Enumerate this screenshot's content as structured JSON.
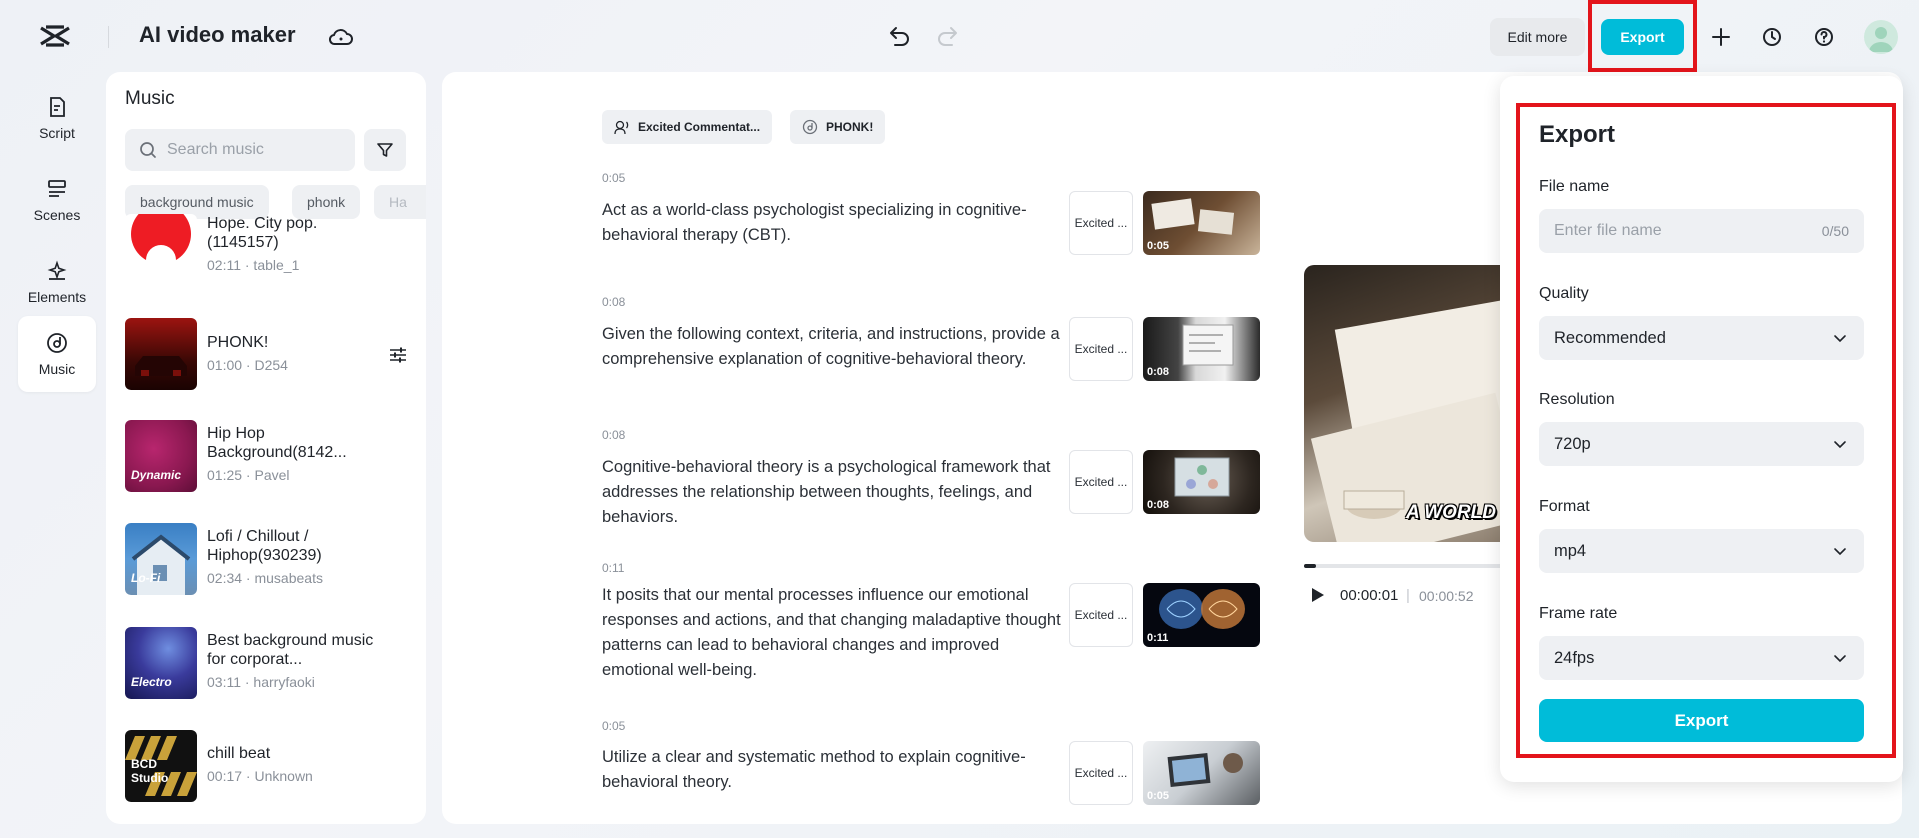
{
  "header": {
    "app_title": "AI video maker",
    "edit_more_label": "Edit more",
    "export_label": "Export"
  },
  "nav": {
    "items": [
      {
        "label": "Script",
        "icon": "script-icon"
      },
      {
        "label": "Scenes",
        "icon": "scenes-icon"
      },
      {
        "label": "Elements",
        "icon": "elements-icon"
      },
      {
        "label": "Music",
        "icon": "music-icon",
        "active": true
      }
    ]
  },
  "music": {
    "title": "Music",
    "search_placeholder": "Search music",
    "chips": [
      "background music",
      "phonk",
      "Ha"
    ],
    "tracks": [
      {
        "name": "Hope. City pop. (1145157)",
        "meta": "02:11 · table_1",
        "thumb_label": ""
      },
      {
        "name": "PHONK!",
        "meta": "01:00 · D254",
        "thumb_label": ""
      },
      {
        "name": "Hip Hop Background(8142...",
        "meta": "01:25 · Pavel",
        "thumb_label": "Dynamic"
      },
      {
        "name": "Lofi / Chillout / Hiphop(930239)",
        "meta": "02:34 · musabeats",
        "thumb_label": "Lo-Fi"
      },
      {
        "name": "Best background music for corporat...",
        "meta": "03:11 · harryfaoki",
        "thumb_label": "Electro"
      },
      {
        "name": "chill beat",
        "meta": "00:17 · Unknown",
        "thumb_label": "BCD Studio"
      }
    ]
  },
  "script": {
    "voice_chip": "Excited Commentat...",
    "music_chip": "PHONK!",
    "segments": [
      {
        "time": "0:05",
        "text": "Act as a world-class psychologist specializing in cognitive-behavioral therapy (CBT).",
        "voice": "Excited ...",
        "dur": "0:05"
      },
      {
        "time": "0:08",
        "text": "Given the following context, criteria, and instructions, provide a comprehensive explanation of cognitive-behavioral theory.",
        "voice": "Excited ...",
        "dur": "0:08"
      },
      {
        "time": "0:08",
        "text": "Cognitive-behavioral theory is a psychological framework that addresses the relationship between thoughts, feelings, and behaviors.",
        "voice": "Excited ...",
        "dur": "0:08"
      },
      {
        "time": "0:11",
        "text": "It posits that our mental processes influence our emotional responses and actions, and that changing maladaptive thought patterns can lead to behavioral changes and improved emotional well-being.",
        "voice": "Excited ...",
        "dur": "0:11"
      },
      {
        "time": "0:05",
        "text": "Utilize a clear and systematic method to explain cognitive-behavioral theory.",
        "voice": "Excited ...",
        "dur": "0:05"
      }
    ]
  },
  "player": {
    "caption": "A WORLD",
    "current_time": "00:00:01",
    "separator": "|",
    "total_time": "00:00:52",
    "progress": 0.06
  },
  "export_panel": {
    "title": "Export",
    "file_name_label": "File name",
    "file_name_placeholder": "Enter file name",
    "file_name_counter": "0/50",
    "quality_label": "Quality",
    "quality_value": "Recommended",
    "resolution_label": "Resolution",
    "resolution_value": "720p",
    "format_label": "Format",
    "format_value": "mp4",
    "frame_rate_label": "Frame rate",
    "frame_rate_value": "24fps",
    "export_button": "Export"
  },
  "colors": {
    "accent": "#00bcd9",
    "highlight": "#e3141b"
  }
}
